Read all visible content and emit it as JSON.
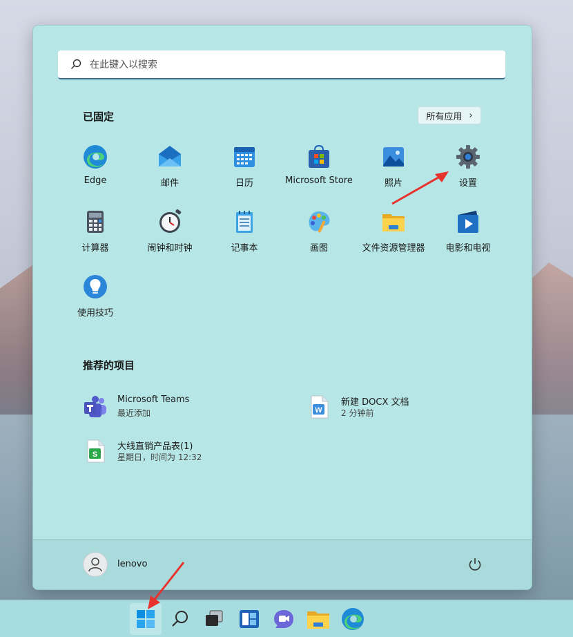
{
  "search": {
    "placeholder": "在此键入以搜索"
  },
  "pinned": {
    "title": "已固定",
    "all_apps_label": "所有应用",
    "apps": [
      {
        "label": "Edge",
        "icon": "edge-icon"
      },
      {
        "label": "邮件",
        "icon": "mail-icon"
      },
      {
        "label": "日历",
        "icon": "calendar-icon"
      },
      {
        "label": "Microsoft Store",
        "icon": "store-icon"
      },
      {
        "label": "照片",
        "icon": "photos-icon"
      },
      {
        "label": "设置",
        "icon": "gear-icon"
      },
      {
        "label": "计算器",
        "icon": "calculator-icon"
      },
      {
        "label": "闹钟和时钟",
        "icon": "clock-icon"
      },
      {
        "label": "记事本",
        "icon": "notepad-icon"
      },
      {
        "label": "画图",
        "icon": "paint-icon"
      },
      {
        "label": "文件资源管理器",
        "icon": "folder-icon"
      },
      {
        "label": "电影和电视",
        "icon": "movies-icon"
      },
      {
        "label": "使用技巧",
        "icon": "tips-icon"
      }
    ]
  },
  "recommended": {
    "title": "推荐的项目",
    "items": [
      {
        "name": "Microsoft Teams",
        "sub": "最近添加",
        "icon": "teams-icon"
      },
      {
        "name": "新建 DOCX 文档",
        "sub": "2 分钟前",
        "icon": "word-document-icon"
      },
      {
        "name": "大线直销产品表(1)",
        "sub": "星期日，时间为 12:32",
        "icon": "spreadsheet-icon"
      }
    ]
  },
  "footer": {
    "user_name": "lenovo"
  },
  "colors": {
    "menu_bg": "#b7e6e6",
    "accent": "#3a6e8a",
    "arrow": "#e8322e"
  }
}
